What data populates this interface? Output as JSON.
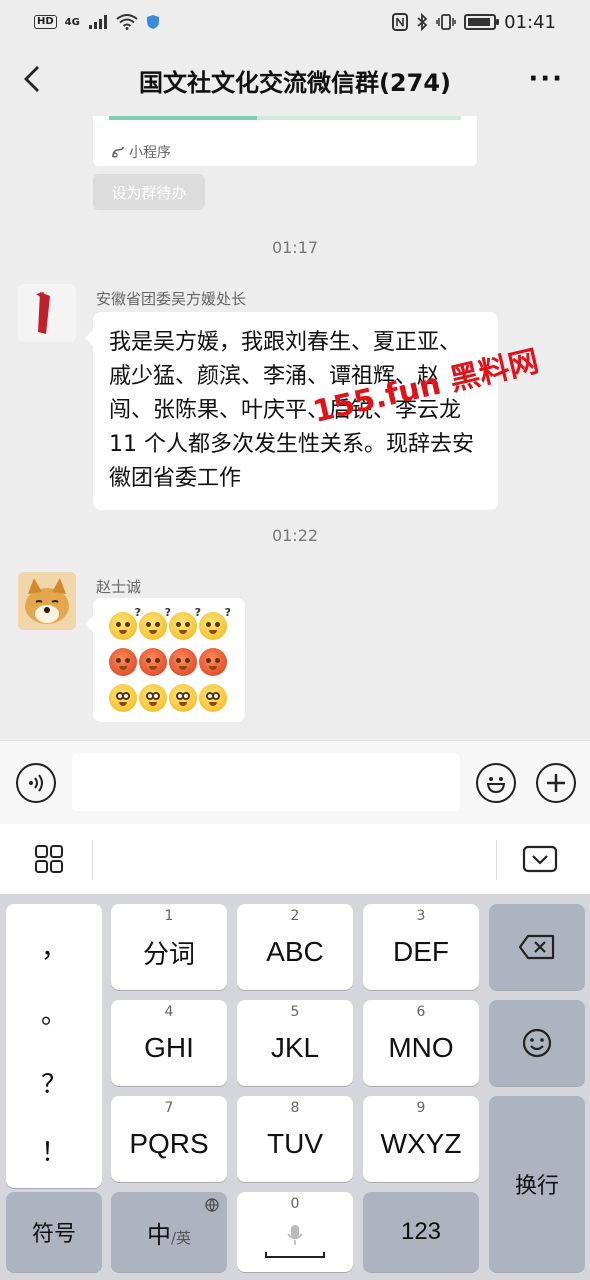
{
  "status_bar": {
    "hd": "HD",
    "network": "4G",
    "time": "01:41"
  },
  "nav": {
    "title": "国文社文化交流微信群(274)",
    "back_icon": "chevron-left-icon",
    "more_icon": "more-dots-icon"
  },
  "chat": {
    "mini_program_label": "小程序",
    "mini_program_progress": 0.42,
    "todo_label": "设为群待办",
    "messages": [
      {
        "time": "01:17",
        "sender": "安徽省团委吴方媛处长",
        "text": "我是吴方媛，我跟刘春生、夏正亚、戚少猛、颜滨、李涌、谭祖辉、赵闯、张陈果、叶庆平、后锐、李云龙 11 个人都多次发生性关系。现辞去安徽团省委工作"
      },
      {
        "time": "01:22",
        "sender": "赵士诚",
        "stickers": [
          "thinking",
          "thinking",
          "thinking",
          "thinking",
          "angry",
          "angry",
          "angry",
          "angry",
          "shocked",
          "shocked",
          "shocked",
          "shocked"
        ]
      }
    ],
    "watermark": "155.fun 黑料网"
  },
  "input_bar": {
    "voice_icon": "voice-icon",
    "emoji_icon": "emoji-icon",
    "add_icon": "plus-icon"
  },
  "keyboard": {
    "punctuation": [
      "，",
      "。",
      "？",
      "！"
    ],
    "rows": [
      [
        {
          "num": "1",
          "label": "分词"
        },
        {
          "num": "2",
          "label": "ABC"
        },
        {
          "num": "3",
          "label": "DEF"
        }
      ],
      [
        {
          "num": "4",
          "label": "GHI"
        },
        {
          "num": "5",
          "label": "JKL"
        },
        {
          "num": "6",
          "label": "MNO"
        }
      ],
      [
        {
          "num": "7",
          "label": "PQRS"
        },
        {
          "num": "8",
          "label": "TUV"
        },
        {
          "num": "9",
          "label": "WXYZ"
        }
      ]
    ],
    "symbol_key": "符号",
    "lang_key_main": "中",
    "lang_key_sub": "/英",
    "space_num": "0",
    "num_key": "123",
    "enter_key": "换行"
  },
  "colors": {
    "watermark": "#e0131a",
    "chat_bg": "#ededed",
    "keyboard_bg": "#d4d6dc",
    "dark_key": "#aeb4bf"
  }
}
